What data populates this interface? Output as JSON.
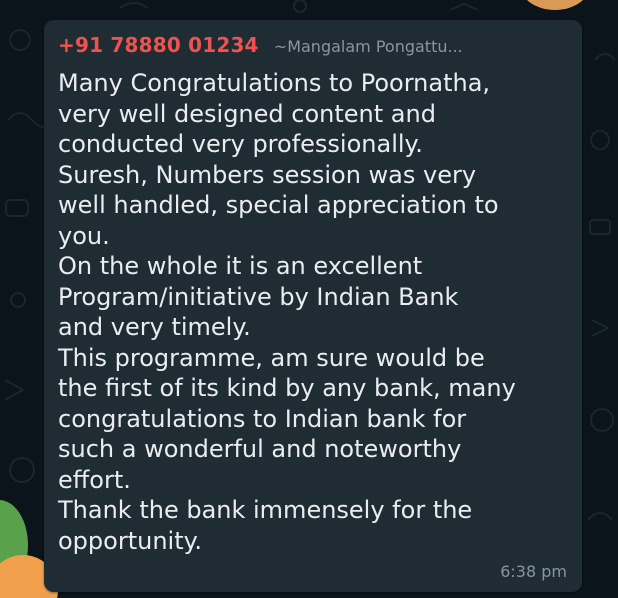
{
  "chat": {
    "background_color": "#0b141a",
    "bubble_color": "#202c33",
    "message": {
      "sender_phone": "+91 78880 01234",
      "sender_phone_color": "#ef5350",
      "sender_name": "~Mangalam Pongattu...",
      "lines": [
        "Many Congratulations to Poornatha,",
        "very well designed content and",
        "conducted very professionally.",
        "Suresh, Numbers session was very",
        "well handled, special appreciation to",
        "you.",
        "On the whole it is an excellent",
        "Program/initiative by Indian Bank",
        "and very timely.",
        "This programme, am sure would be",
        "the first of its kind by any bank, many",
        "congratulations to Indian bank for",
        "such a wonderful and noteworthy",
        "effort.",
        "Thank the bank immensely for the",
        "opportunity."
      ],
      "time": "6:38 pm"
    }
  }
}
